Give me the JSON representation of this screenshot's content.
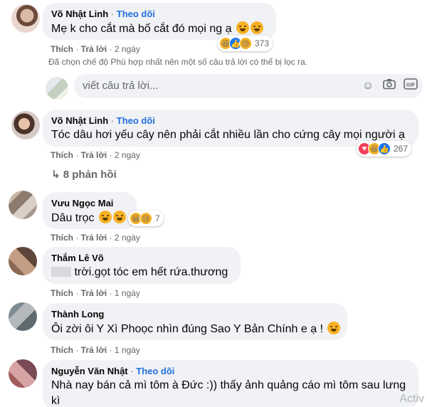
{
  "follow_label": "Theo dõi",
  "like_label": "Thích",
  "reply_label": "Trả lời",
  "comments": [
    {
      "author": "Võ Nhật Linh",
      "text": "Mẹ k cho cắt mà bố cắt đó mọi ng ạ",
      "time": "2 ngày",
      "reaction_count": "373"
    },
    {
      "author": "Võ Nhật Linh",
      "text": "Tóc dâu hơi yếu cây nên phải cắt nhiều lần cho cứng cây mọi người ạ",
      "time": "2 ngày",
      "reaction_count": "267",
      "replies": "8 phản hồi"
    },
    {
      "author": "Vưu Ngọc Mai",
      "text": "Dâu trọc",
      "time": "2 ngày",
      "reaction_count": "7"
    },
    {
      "author": "Thắm Lê Võ",
      "text": "trời.gọt tóc em hết rứa.thương",
      "time": "1 ngày"
    },
    {
      "author": "Thành Long",
      "text": "Ôi zời ôi Y Xì Phoọc nhìn đúng Sao Y Bản Chính e ạ !",
      "time": "1 ngày"
    },
    {
      "author": "Nguyễn Văn Nhật",
      "text": "Nhà nay bán cả mì tôm à Đức :)) thấy ảnh quảng cáo mì tôm sau lưng",
      "text2": "kì"
    }
  ],
  "filter_note": "Đã chọn chế độ Phù hợp nhất nên một số câu trả lời có thể bị lọc ra.",
  "reply_placeholder": "viết câu trả lời...",
  "icons": [
    "emoji-icon",
    "camera-icon",
    "gif-icon"
  ],
  "gif_label": "GIF",
  "watermark": "Activ"
}
